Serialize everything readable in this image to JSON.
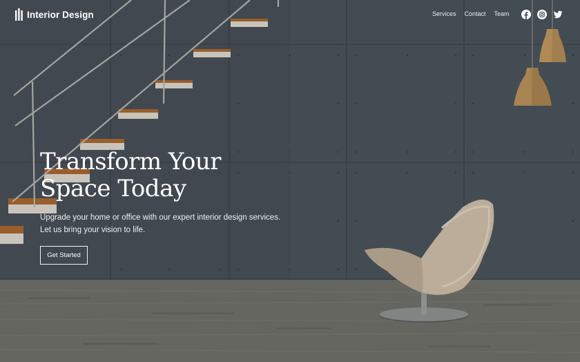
{
  "brand": {
    "name": "Interior Design",
    "icon": "bars-logo-icon"
  },
  "nav": {
    "items": [
      {
        "label": "Services"
      },
      {
        "label": "Contact"
      },
      {
        "label": "Team"
      }
    ]
  },
  "social": [
    {
      "icon": "facebook-icon"
    },
    {
      "icon": "instagram-icon"
    },
    {
      "icon": "twitter-icon"
    }
  ],
  "hero": {
    "title_lines": [
      "Transform Your",
      "Space Today"
    ],
    "subtitle_lines": [
      "Upgrade your home or office with our expert interior design services.",
      "Let us bring your vision to life."
    ],
    "cta_label": "Get Started"
  },
  "colors": {
    "wall": "#4a535b",
    "floor": "#6f706a",
    "text": "#ffffff",
    "lamp": "#b08a55",
    "chair": "#cbbca6"
  }
}
